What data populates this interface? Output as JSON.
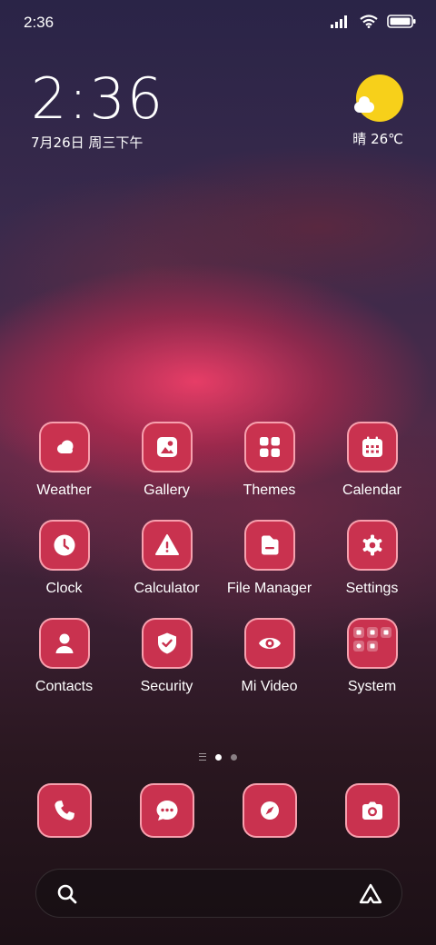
{
  "status_bar": {
    "time": "2:36"
  },
  "clock_widget": {
    "time": "2:36",
    "date": "7月26日 周三下午"
  },
  "weather_widget": {
    "condition": "晴",
    "temperature": "26℃",
    "icon": "sunny-partly-cloudy-icon"
  },
  "apps": [
    {
      "label": "Weather",
      "icon": "weather-icon"
    },
    {
      "label": "Gallery",
      "icon": "gallery-icon"
    },
    {
      "label": "Themes",
      "icon": "themes-icon"
    },
    {
      "label": "Calendar",
      "icon": "calendar-icon"
    },
    {
      "label": "Clock",
      "icon": "clock-icon"
    },
    {
      "label": "Calculator",
      "icon": "warning-triangle-icon"
    },
    {
      "label": "File Manager",
      "icon": "folder-icon"
    },
    {
      "label": "Settings",
      "icon": "gear-icon"
    },
    {
      "label": "Contacts",
      "icon": "person-icon"
    },
    {
      "label": "Security",
      "icon": "shield-check-icon"
    },
    {
      "label": "Mi Video",
      "icon": "eye-icon"
    },
    {
      "label": "System",
      "icon": "folder-grid-icon"
    }
  ],
  "dock": [
    {
      "icon": "phone-icon"
    },
    {
      "icon": "messages-icon"
    },
    {
      "icon": "compass-icon"
    },
    {
      "icon": "camera-icon"
    }
  ],
  "page_indicator": {
    "pages": 2,
    "current": 1
  },
  "search": {
    "placeholder": ""
  },
  "colors": {
    "icon_bg": "#c9324f",
    "icon_border": "#ffb4be",
    "sun": "#f7d01a"
  }
}
